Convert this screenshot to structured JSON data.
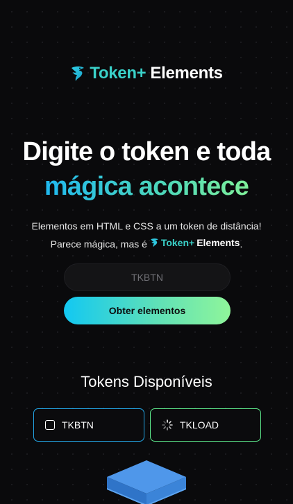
{
  "brand": {
    "part1": "Token+",
    "part2": "Elements",
    "icon": "dolphin-icon",
    "color1": "#3ad1c9"
  },
  "hero": {
    "line1": "Digite o token e toda",
    "line2": "mágica acontece"
  },
  "description": {
    "line1": "Elementos em HTML e CSS a um token de distância!",
    "line2_prefix": "Parece mágica, mas é",
    "brand_part1": "Token+",
    "brand_part2": "Elements",
    "line2_suffix": "."
  },
  "token_input": {
    "placeholder": "TKBTN",
    "value": ""
  },
  "submit_button": {
    "label": "Obter elementos"
  },
  "tokens_section": {
    "title": "Tokens Disponíveis",
    "items": [
      {
        "label": "TKBTN",
        "icon": "checkbox-icon",
        "border_color": "#23a6e6"
      },
      {
        "label": "TKLOAD",
        "icon": "loading-spinner-icon",
        "border_color": "#5ce68a"
      }
    ]
  },
  "illustration": {
    "icon": "layers-stack-icon",
    "color": "#4a90e2"
  }
}
